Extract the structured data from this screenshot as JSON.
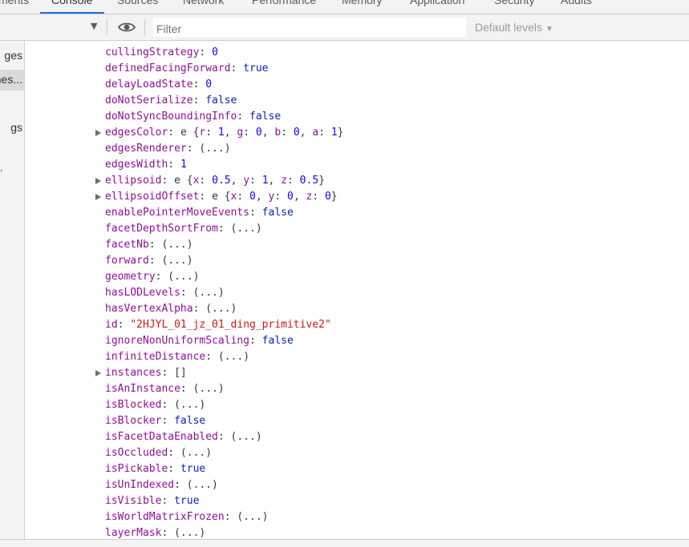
{
  "tabs": [
    {
      "label": "ments"
    },
    {
      "label": "Console"
    },
    {
      "label": "Sources"
    },
    {
      "label": "Network"
    },
    {
      "label": "Performance"
    },
    {
      "label": "Memory"
    },
    {
      "label": "Application"
    },
    {
      "label": "Security"
    },
    {
      "label": "Audits"
    }
  ],
  "toolbar": {
    "filter_placeholder": "Filter",
    "levels_label": "Default levels",
    "levels_arrow": "▼",
    "context_arrow": "▼"
  },
  "sidebar": {
    "items": [
      {
        "label": "ges"
      },
      {
        "label": "nes..."
      },
      {
        "label": "gs"
      }
    ],
    "fragment": ","
  },
  "console": {
    "properties": [
      {
        "key": "cullingStrategy",
        "value": "0",
        "type": "num",
        "expandable": false
      },
      {
        "key": "definedFacingForward",
        "value": "true",
        "type": "bool",
        "expandable": false
      },
      {
        "key": "delayLoadState",
        "value": "0",
        "type": "num",
        "expandable": false
      },
      {
        "key": "doNotSerialize",
        "value": "false",
        "type": "bool",
        "expandable": false
      },
      {
        "key": "doNotSyncBoundingInfo",
        "value": "false",
        "type": "bool",
        "expandable": false
      },
      {
        "key": "edgesColor",
        "value": "e {r: 1, g: 0, b: 0, a: 1}",
        "type": "obj",
        "expandable": true,
        "obj": {
          "cls": "e",
          "fields": [
            {
              "k": "r",
              "v": "1"
            },
            {
              "k": "g",
              "v": "0"
            },
            {
              "k": "b",
              "v": "0"
            },
            {
              "k": "a",
              "v": "1"
            }
          ]
        }
      },
      {
        "key": "edgesRenderer",
        "value": "(...)",
        "type": "lazy",
        "expandable": false
      },
      {
        "key": "edgesWidth",
        "value": "1",
        "type": "num",
        "expandable": false
      },
      {
        "key": "ellipsoid",
        "value": "e {x: 0.5, y: 1, z: 0.5}",
        "type": "obj",
        "expandable": true,
        "obj": {
          "cls": "e",
          "fields": [
            {
              "k": "x",
              "v": "0.5"
            },
            {
              "k": "y",
              "v": "1"
            },
            {
              "k": "z",
              "v": "0.5"
            }
          ]
        }
      },
      {
        "key": "ellipsoidOffset",
        "value": "e {x: 0, y: 0, z: 0}",
        "type": "obj",
        "expandable": true,
        "obj": {
          "cls": "e",
          "fields": [
            {
              "k": "x",
              "v": "0"
            },
            {
              "k": "y",
              "v": "0"
            },
            {
              "k": "z",
              "v": "0"
            }
          ]
        }
      },
      {
        "key": "enablePointerMoveEvents",
        "value": "false",
        "type": "bool",
        "expandable": false
      },
      {
        "key": "facetDepthSortFrom",
        "value": "(...)",
        "type": "lazy",
        "expandable": false
      },
      {
        "key": "facetNb",
        "value": "(...)",
        "type": "lazy",
        "expandable": false
      },
      {
        "key": "forward",
        "value": "(...)",
        "type": "lazy",
        "expandable": false
      },
      {
        "key": "geometry",
        "value": "(...)",
        "type": "lazy",
        "expandable": false
      },
      {
        "key": "hasLODLevels",
        "value": "(...)",
        "type": "lazy",
        "expandable": false
      },
      {
        "key": "hasVertexAlpha",
        "value": "(...)",
        "type": "lazy",
        "expandable": false
      },
      {
        "key": "id",
        "value": "\"2HJYL_01_jz_01_ding_primitive2\"",
        "type": "str",
        "expandable": false
      },
      {
        "key": "ignoreNonUniformScaling",
        "value": "false",
        "type": "bool",
        "expandable": false
      },
      {
        "key": "infiniteDistance",
        "value": "(...)",
        "type": "lazy",
        "expandable": false
      },
      {
        "key": "instances",
        "value": "[]",
        "type": "arr",
        "expandable": true
      },
      {
        "key": "isAnInstance",
        "value": "(...)",
        "type": "lazy",
        "expandable": false
      },
      {
        "key": "isBlocked",
        "value": "(...)",
        "type": "lazy",
        "expandable": false
      },
      {
        "key": "isBlocker",
        "value": "false",
        "type": "bool",
        "expandable": false
      },
      {
        "key": "isFacetDataEnabled",
        "value": "(...)",
        "type": "lazy",
        "expandable": false
      },
      {
        "key": "isOccluded",
        "value": "(...)",
        "type": "lazy",
        "expandable": false
      },
      {
        "key": "isPickable",
        "value": "true",
        "type": "bool",
        "expandable": false
      },
      {
        "key": "isUnIndexed",
        "value": "(...)",
        "type": "lazy",
        "expandable": false
      },
      {
        "key": "isVisible",
        "value": "true",
        "type": "bool",
        "expandable": false
      },
      {
        "key": "isWorldMatrixFrozen",
        "value": "(...)",
        "type": "lazy",
        "expandable": false
      },
      {
        "key": "layerMask",
        "value": "(...)",
        "type": "lazy",
        "expandable": false
      }
    ]
  },
  "colors": {
    "accent": "#1a73e8",
    "key": "#881391",
    "number": "#1c00cf",
    "boolean": "#0d22aa",
    "string": "#c41a16"
  }
}
